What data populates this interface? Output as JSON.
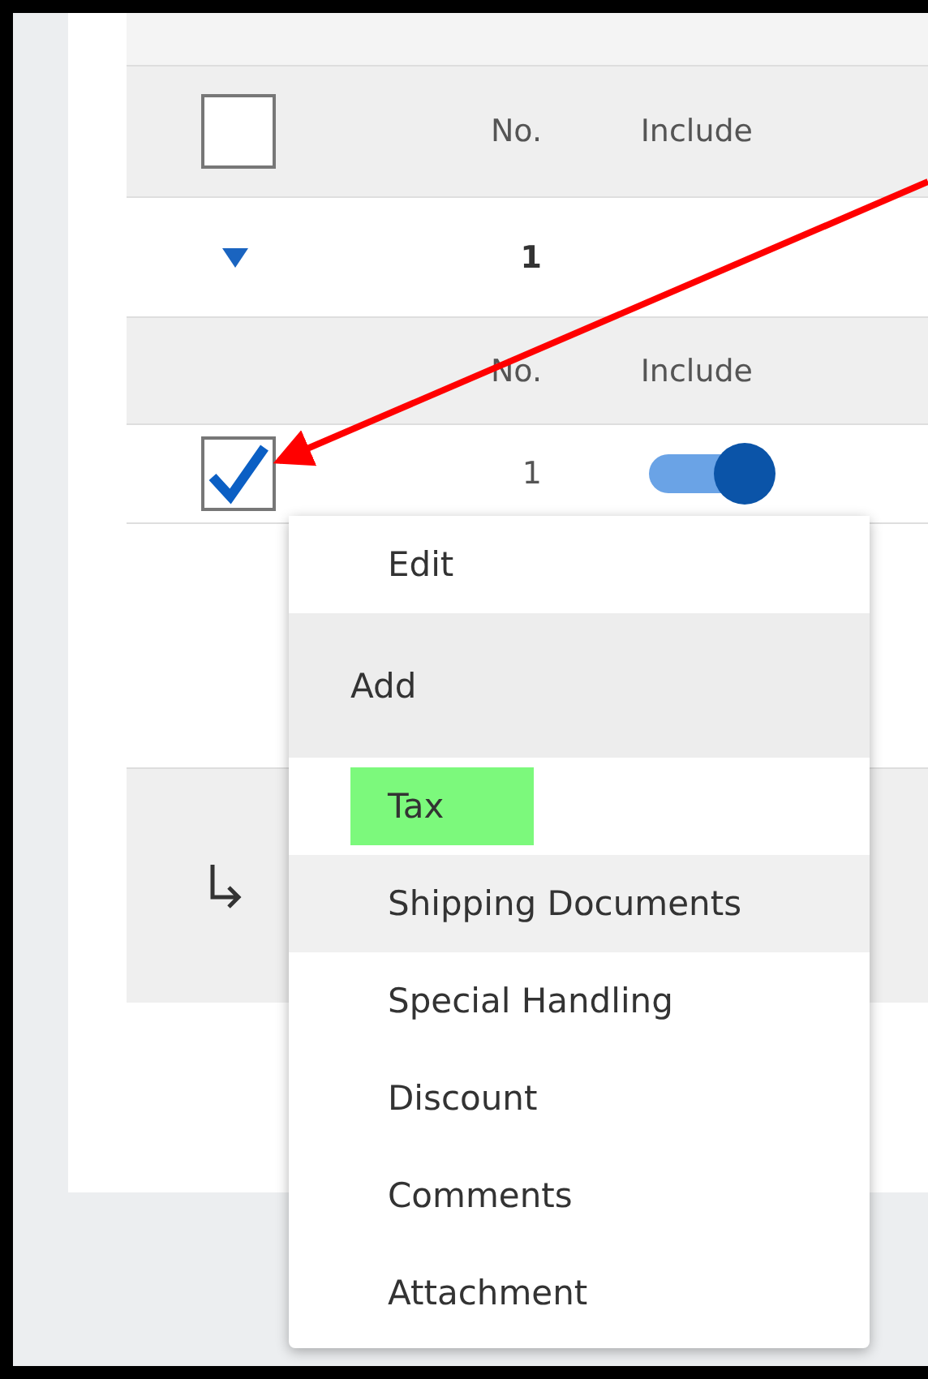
{
  "table": {
    "header": {
      "checked": false,
      "columns": [
        "No.",
        "Include"
      ]
    },
    "group_row": {
      "expanded": true,
      "number": "1"
    },
    "sub_header": {
      "columns": [
        "No.",
        "Include"
      ]
    },
    "item_row": {
      "checked": true,
      "number": "1",
      "include_on": true
    }
  },
  "context_menu": {
    "items": [
      {
        "kind": "action",
        "label": "Edit",
        "highlighted": false,
        "hovered": false
      },
      {
        "kind": "group",
        "label": "Add",
        "highlighted": false,
        "hovered": false
      },
      {
        "kind": "subitem",
        "label": "Tax",
        "highlighted": true,
        "hovered": false
      },
      {
        "kind": "subitem",
        "label": "Shipping Documents",
        "highlighted": false,
        "hovered": true
      },
      {
        "kind": "subitem",
        "label": "Special Handling",
        "highlighted": false,
        "hovered": false
      },
      {
        "kind": "subitem",
        "label": "Discount",
        "highlighted": false,
        "hovered": false
      },
      {
        "kind": "subitem",
        "label": "Comments",
        "highlighted": false,
        "hovered": false
      },
      {
        "kind": "subitem",
        "label": "Attachment",
        "highlighted": false,
        "hovered": false
      }
    ]
  }
}
